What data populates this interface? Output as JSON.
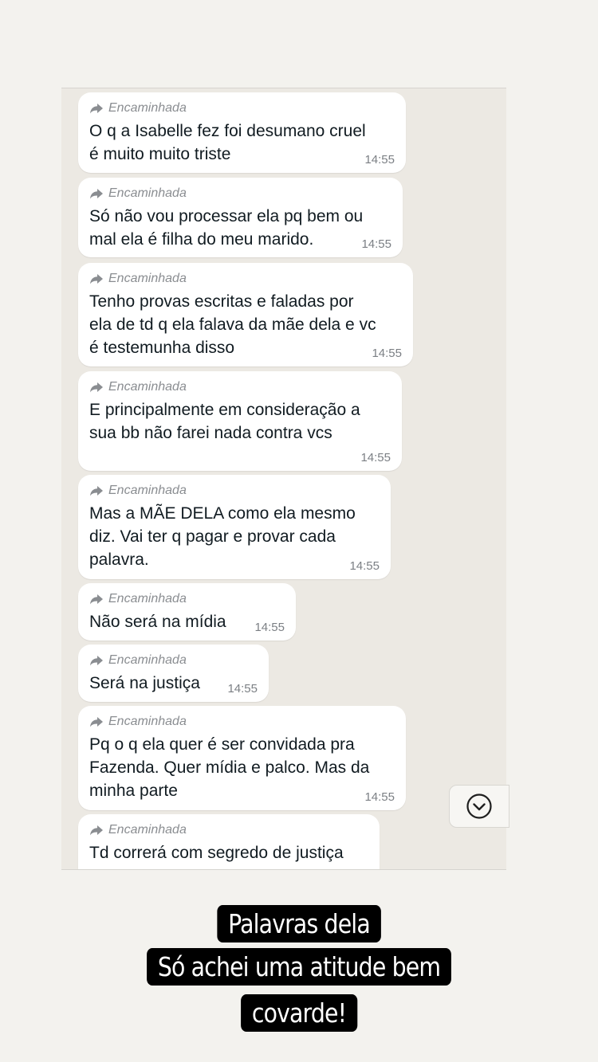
{
  "forward_label": "Encaminhada",
  "messages": [
    {
      "text": "O q a Isabelle fez foi desumano cruel\né muito muito triste",
      "time": "14:55"
    },
    {
      "text": "Só não vou processar ela pq bem ou\nmal ela é filha do meu marido.",
      "time": "14:55"
    },
    {
      "text": "Tenho provas escritas e faladas por\nela de td q ela falava da mãe dela e vc\né testemunha disso",
      "time": "14:55"
    },
    {
      "text": "E principalmente em consideração a\nsua bb não farei nada contra vcs",
      "time": "14:55"
    },
    {
      "text": "Mas a MÃE DELA como ela mesmo\ndiz. Vai ter q pagar e provar cada\npalavra.",
      "time": "14:55"
    },
    {
      "text": "Não será na mídia",
      "time": "14:55"
    },
    {
      "text": "Será na justiça",
      "time": "14:55"
    },
    {
      "text": "Pq o q ela quer é ser convidada pra\nFazenda. Quer mídia e palco. Mas da\nminha parte",
      "time": "14:55"
    },
    {
      "text": "Td correrá com segredo de justiça",
      "time": ""
    }
  ],
  "caption": {
    "line1": "Palavras dela",
    "line2": "Só achei uma atitude bem",
    "line3": "covarde!"
  },
  "icons": {
    "forward": "forward-arrow-icon",
    "scroll_down": "chevron-down-circle-icon"
  },
  "colors": {
    "background": "#f3f2ee",
    "chat_background": "#ece9e3",
    "bubble": "#ffffff",
    "caption_bg": "#000000"
  }
}
